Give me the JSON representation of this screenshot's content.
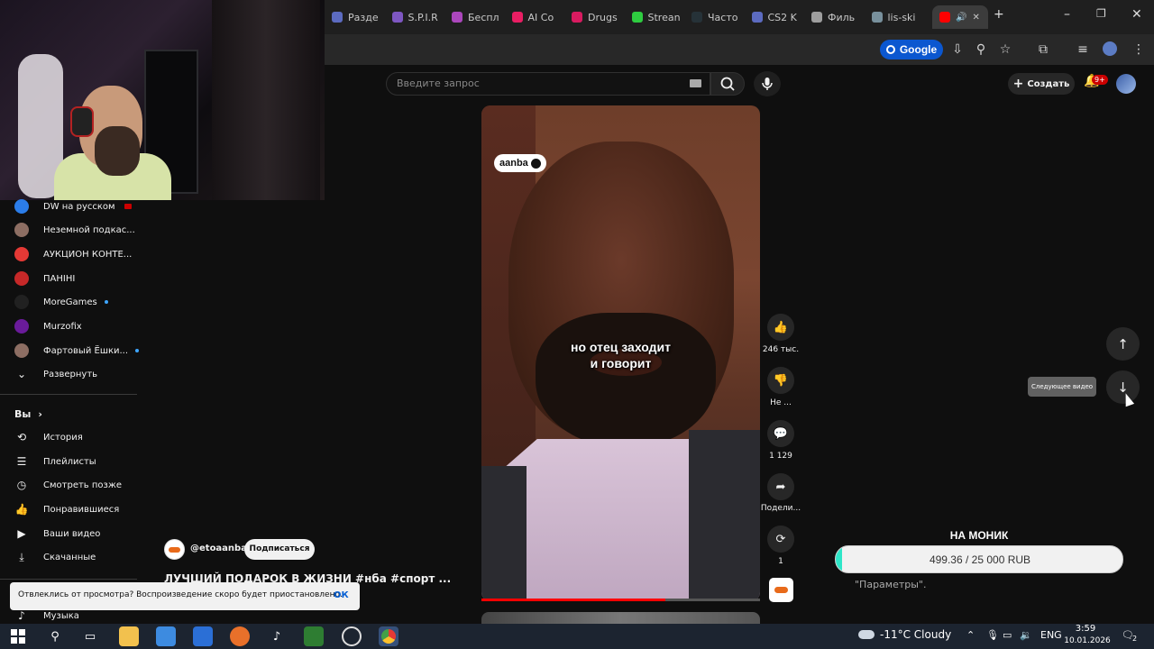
{
  "browser": {
    "tabs": [
      {
        "label": "Разде",
        "color": "#5c6bc0"
      },
      {
        "label": "S.P.I.R",
        "color": "#7e57c2"
      },
      {
        "label": "Беспл",
        "color": "#ab47bc"
      },
      {
        "label": "AI Co",
        "color": "#e91e63"
      },
      {
        "label": "Drugs",
        "color": "#d81b60"
      },
      {
        "label": "Strean",
        "color": "#2ecc40"
      },
      {
        "label": "Часто",
        "color": "#263238"
      },
      {
        "label": "CS2 K",
        "color": "#5c6bc0"
      },
      {
        "label": "Филь",
        "color": "#9e9e9e"
      },
      {
        "label": "lis-ski",
        "color": "#78909c"
      }
    ],
    "active_tab_color": "#ff0000",
    "google_label": "Google",
    "new_tab": "+",
    "minimize": "–",
    "maximize": "❐",
    "close": "✕"
  },
  "header": {
    "search_placeholder": "Введите запрос",
    "create_label": "Создать",
    "notif_count": "9+"
  },
  "sidebar": {
    "subscriptions": [
      {
        "label": "DW на русском",
        "color": "#2b7de9",
        "marker": "live"
      },
      {
        "label": "Неземной подкас...",
        "color": "#8d6e63",
        "marker": ""
      },
      {
        "label": "АУКЦИОН КОНТЕ...",
        "color": "#e53935",
        "marker": ""
      },
      {
        "label": "ПАНІНІ",
        "color": "#c62828",
        "marker": ""
      },
      {
        "label": "MoreGames",
        "color": "#212121",
        "marker": "dot"
      },
      {
        "label": "Murzofix",
        "color": "#6a1b9a",
        "marker": ""
      },
      {
        "label": "Фартовый Ёшки...",
        "color": "#8d6e63",
        "marker": "dot"
      }
    ],
    "expand_label": "Развернуть",
    "you_label": "Вы",
    "you_items": [
      {
        "label": "История",
        "icon": "history-icon",
        "glyph": "⟲"
      },
      {
        "label": "Плейлисты",
        "icon": "playlists-icon",
        "glyph": "☰"
      },
      {
        "label": "Смотреть позже",
        "icon": "clock-icon",
        "glyph": "◷"
      },
      {
        "label": "Понравившиеся",
        "icon": "thumb-up-icon",
        "glyph": "👍"
      },
      {
        "label": "Ваши видео",
        "icon": "video-icon",
        "glyph": "▶"
      },
      {
        "label": "Скачанные",
        "icon": "download-icon",
        "glyph": "⤓"
      }
    ],
    "music_label": "Музыка"
  },
  "video": {
    "logo": "aanba",
    "subtitle_line1": "но отец заходит",
    "subtitle_line2": "и говорит",
    "progress": 0.66,
    "channel": "@etoaanba",
    "subscribe_label": "Подписаться",
    "title": "ЛУЧШИЙ ПОДАРОК В ЖИЗНИ #нба #спорт ..."
  },
  "actions": {
    "likes": "246 тыс.",
    "dislike": "Не ...",
    "comments": "1 129",
    "share": "Подели...",
    "remix": "1"
  },
  "nav": {
    "next_tooltip": "Следующее видео"
  },
  "donation": {
    "title": "НА МОНИК",
    "progress_text": "499.36 / 25 000 RUB",
    "current": 499.36,
    "goal": 25000,
    "params_text": "\"Параметры\"."
  },
  "toast": {
    "text": "Отвлеклись от просмотра? Воспроизведение скоро будет приостановлено.",
    "ok": "ОК"
  },
  "taskbar": {
    "weather": "-11°C  Cloudy",
    "lang": "ENG",
    "time": "3:59",
    "date": "10.01.2026",
    "notifications": "2"
  }
}
